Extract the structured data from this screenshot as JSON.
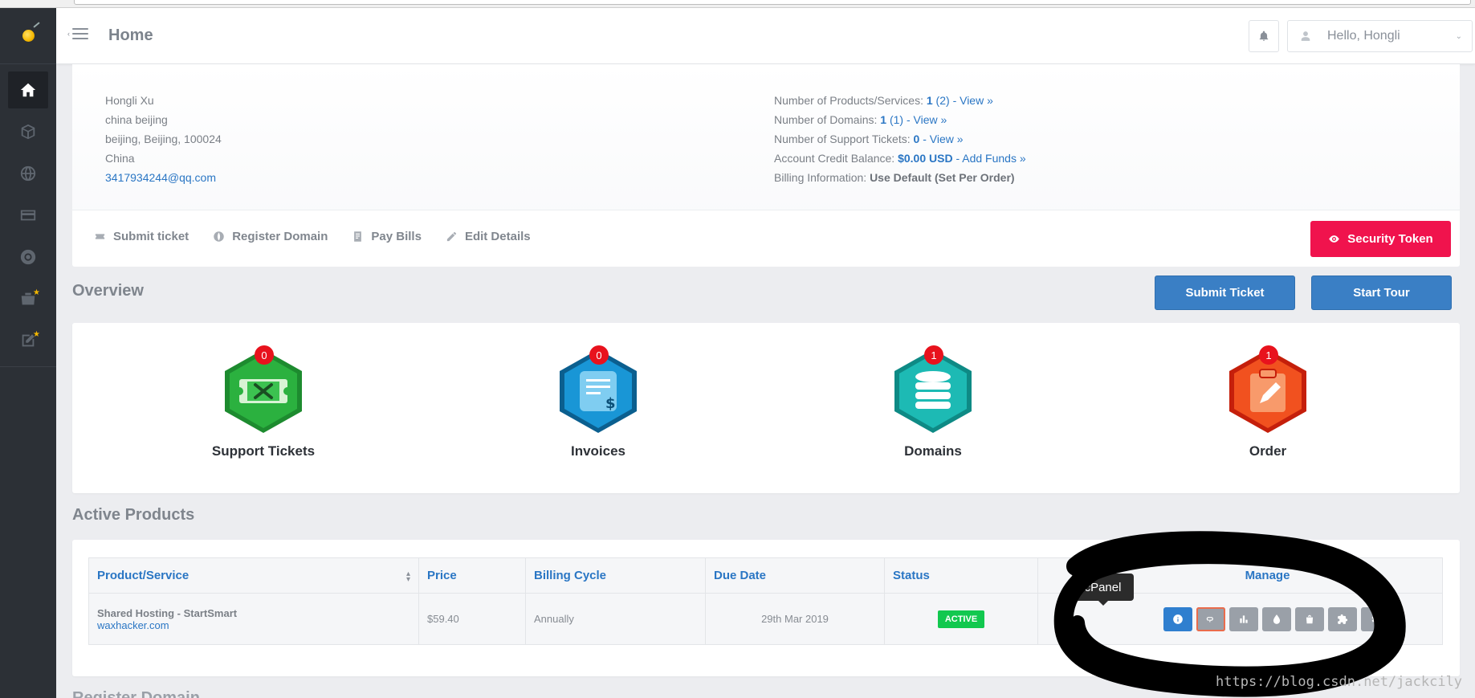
{
  "header": {
    "title": "Home",
    "user_greeting": "Hello, Hongli"
  },
  "sidebar": {
    "items": [
      {
        "name": "home",
        "icon": "home-icon",
        "active": true
      },
      {
        "name": "services",
        "icon": "cube-icon"
      },
      {
        "name": "domains",
        "icon": "globe-icon"
      },
      {
        "name": "billing",
        "icon": "credit-card-icon"
      },
      {
        "name": "support",
        "icon": "lifebuoy-icon"
      },
      {
        "name": "store",
        "icon": "store-icon",
        "starred": true
      },
      {
        "name": "affiliates",
        "icon": "edit-icon",
        "starred": true
      }
    ]
  },
  "account": {
    "name": "Hongli Xu",
    "address1": "china beijing",
    "address2": "beijing, Beijing, 100024",
    "country": "China",
    "email": "3417934244@qq.com"
  },
  "stats": {
    "products_label": "Number of Products/Services:",
    "products_count": "1",
    "products_total": "(2)",
    "products_link": "- View »",
    "domains_label": "Number of Domains:",
    "domains_count": "1",
    "domains_total": "(1)",
    "domains_link": "- View »",
    "tickets_label": "Number of Support Tickets:",
    "tickets_count": "0",
    "tickets_link": "- View »",
    "credit_label": "Account Credit Balance:",
    "credit_value": "$0.00 USD",
    "credit_link": "- Add Funds »",
    "billing_label": "Billing Information:",
    "billing_value": "Use Default (Set Per Order)"
  },
  "actions": {
    "submit_ticket": "Submit ticket",
    "register_domain": "Register Domain",
    "pay_bills": "Pay Bills",
    "edit_details": "Edit Details",
    "security_token": "Security Token"
  },
  "overview": {
    "title": "Overview",
    "submit_ticket_btn": "Submit Ticket",
    "start_tour_btn": "Start Tour",
    "tiles": [
      {
        "label": "Support Tickets",
        "count": "0",
        "color": "#22a83a"
      },
      {
        "label": "Invoices",
        "count": "0",
        "color": "#1a8fd0"
      },
      {
        "label": "Domains",
        "count": "1",
        "color": "#1cb6b0"
      },
      {
        "label": "Order",
        "count": "1",
        "color": "#f04b1c"
      }
    ]
  },
  "active_products": {
    "title": "Active Products",
    "columns": [
      "Product/Service",
      "Price",
      "Billing Cycle",
      "Due Date",
      "Status",
      "Manage"
    ],
    "rows": [
      {
        "product": "Shared Hosting - StartSmart",
        "domain": "waxhacker.com",
        "price": "$59.40",
        "cycle": "Annually",
        "due": "29th Mar 2019",
        "status": "ACTIVE"
      }
    ],
    "tooltip": "cPanel"
  },
  "next_section": "Register Domain",
  "watermark": "https://blog.csdn.net/jackcily",
  "colors": {
    "sidebar_bg": "#2c3036",
    "link_blue": "#2a76c4",
    "btn_blue": "#3a7fc5",
    "btn_red": "#f0134d",
    "status_green": "#12c84f",
    "badge_red": "#e8121d"
  }
}
